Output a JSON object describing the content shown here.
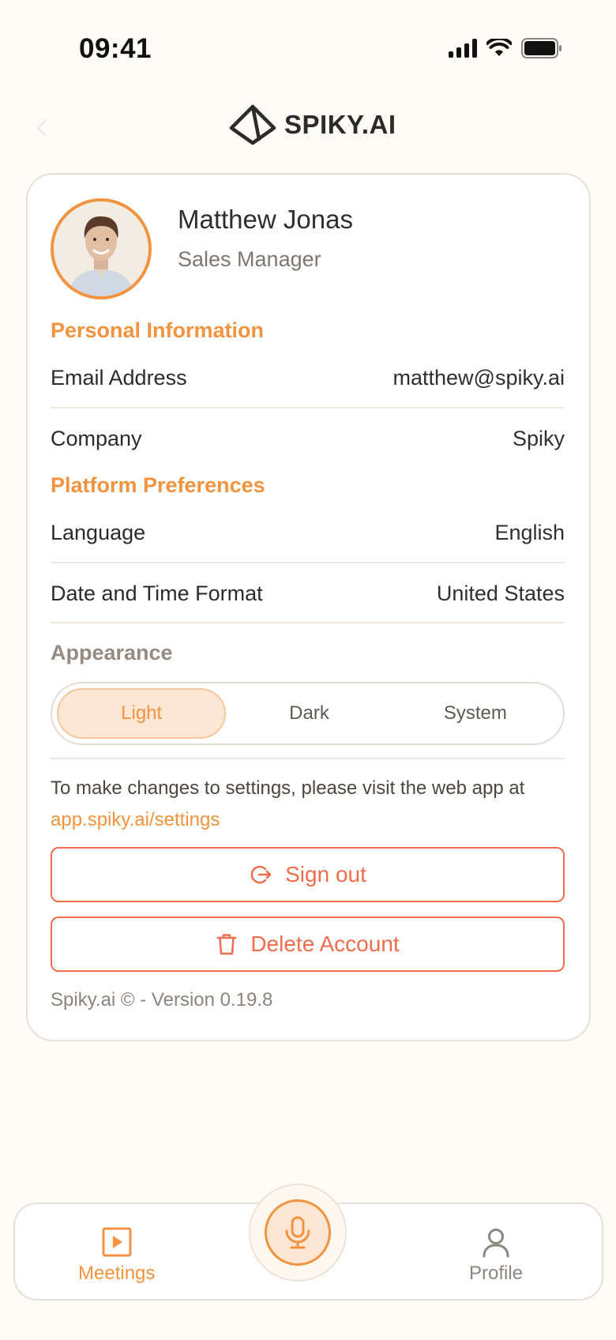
{
  "status_bar": {
    "time": "09:41"
  },
  "header": {
    "brand": "SPIKY.AI"
  },
  "profile": {
    "name": "Matthew Jonas",
    "role": "Sales Manager"
  },
  "personal_info": {
    "title": "Personal Information",
    "rows": [
      {
        "label": "Email Address",
        "value": "matthew@spiky.ai"
      },
      {
        "label": "Company",
        "value": "Spiky"
      }
    ]
  },
  "platform_prefs": {
    "title": "Platform Preferences",
    "rows": [
      {
        "label": "Language",
        "value": "English"
      },
      {
        "label": "Date and Time Format",
        "value": "United States"
      }
    ]
  },
  "appearance": {
    "title": "Appearance",
    "options": [
      "Light",
      "Dark",
      "System"
    ],
    "selected": "Light"
  },
  "note": {
    "text": "To make changes to settings, please visit the web app at",
    "link": "app.spiky.ai/settings"
  },
  "actions": {
    "sign_out": "Sign out",
    "delete_account": "Delete Account"
  },
  "footer": {
    "version_text": "Spiky.ai © - Version 0.19.8"
  },
  "tabbar": {
    "meetings": "Meetings",
    "profile": "Profile",
    "active": "Meetings"
  },
  "colors": {
    "accent": "#f2933f",
    "danger": "#ef6d4d",
    "background": "#fffbf5"
  }
}
